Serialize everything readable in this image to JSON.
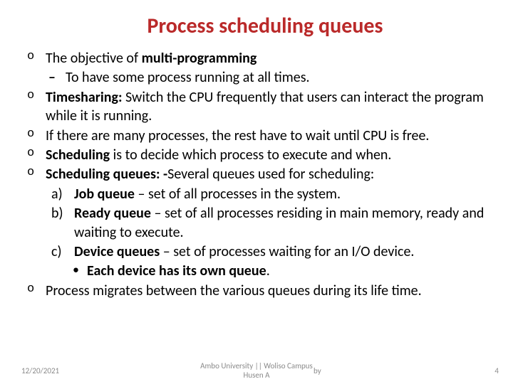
{
  "title": "Process scheduling queues",
  "b1_pre": "The objective of ",
  "b1_bold": "multi-programming",
  "b1_sub": "To have some process running at all times.",
  "b2_bold": "Timesharing:",
  "b2_rest": " Switch the CPU frequently that users can interact the program while it is running.",
  "b3": "If there are many processes, the rest have to wait until CPU is free.",
  "b4_bold": "Scheduling",
  "b4_rest": " is to decide which process to execute and when.",
  "b5_bold": "Scheduling queues: -",
  "b5_rest": "Several queues used for scheduling:",
  "sq_a_m": "a)",
  "sq_a_bold": "Job queue",
  "sq_a_rest": " – set of all processes in the system.",
  "sq_b_m": "b)",
  "sq_b_bold": "Ready queue",
  "sq_b_rest": " – set of all processes residing in main memory, ready and waiting to execute.",
  "sq_c_m": "c)",
  "sq_c_bold": "Device queues",
  "sq_c_rest": " – set of processes waiting for an I/O device.",
  "sq_c_sub_bold": "Each device has its own queue",
  "sq_c_sub_tail": ".",
  "b6": "Process migrates between the various queues during its life time.",
  "footer_date": "12/20/2021",
  "footer_center_l1": "Ambo University || Woliso Campus",
  "footer_center_l2": "Husen A",
  "footer_by": "by",
  "footer_page": "4"
}
